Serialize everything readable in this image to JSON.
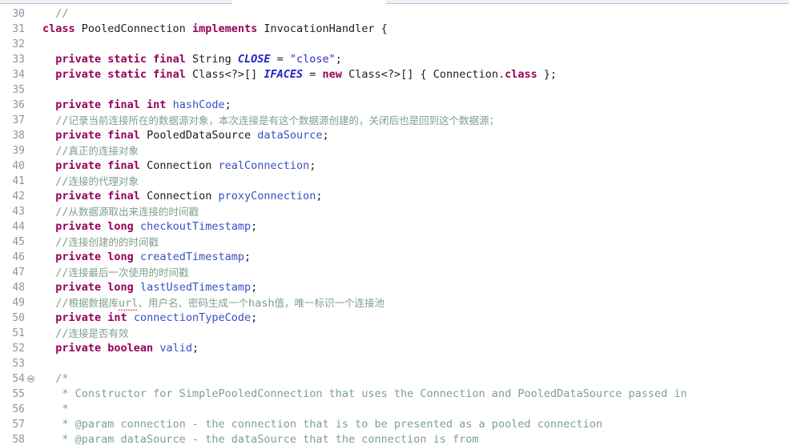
{
  "editor": {
    "language": "Java",
    "theme": "light",
    "first_line": 30,
    "last_line": 58,
    "colors": {
      "background": "#ffffff",
      "gutter_text": "#8f9499",
      "keyword": "#96005a",
      "field": "#3b4ec4",
      "constant": "#2323c8",
      "string": "#2a2ac0",
      "comment": "#7f9f8f",
      "text": "#1d1d1d",
      "spellcheck_underline": "#e05050"
    }
  },
  "lines": [
    {
      "number": "30",
      "fold": false,
      "tokens": [
        {
          "t": "  ",
          "c": "plain"
        },
        {
          "t": "//",
          "c": "cmt"
        }
      ]
    },
    {
      "number": "31",
      "fold": false,
      "tokens": [
        {
          "t": "class",
          "c": "kw"
        },
        {
          "t": " PooledConnection ",
          "c": "type"
        },
        {
          "t": "implements",
          "c": "kw"
        },
        {
          "t": " InvocationHandler {",
          "c": "type"
        }
      ]
    },
    {
      "number": "32",
      "fold": false,
      "tokens": []
    },
    {
      "number": "33",
      "fold": false,
      "tokens": [
        {
          "t": "  ",
          "c": "plain"
        },
        {
          "t": "private static final",
          "c": "kw"
        },
        {
          "t": " String ",
          "c": "type"
        },
        {
          "t": "CLOSE",
          "c": "constant"
        },
        {
          "t": " = ",
          "c": "punct"
        },
        {
          "t": "\"close\"",
          "c": "str"
        },
        {
          "t": ";",
          "c": "punct"
        }
      ]
    },
    {
      "number": "34",
      "fold": false,
      "tokens": [
        {
          "t": "  ",
          "c": "plain"
        },
        {
          "t": "private static final",
          "c": "kw"
        },
        {
          "t": " Class<?>[] ",
          "c": "type"
        },
        {
          "t": "IFACES",
          "c": "constant"
        },
        {
          "t": " = ",
          "c": "punct"
        },
        {
          "t": "new",
          "c": "kw"
        },
        {
          "t": " Class<?>[] { Connection.",
          "c": "type"
        },
        {
          "t": "class",
          "c": "kw"
        },
        {
          "t": " };",
          "c": "punct"
        }
      ]
    },
    {
      "number": "35",
      "fold": false,
      "tokens": []
    },
    {
      "number": "36",
      "fold": false,
      "tokens": [
        {
          "t": "  ",
          "c": "plain"
        },
        {
          "t": "private final int",
          "c": "kw"
        },
        {
          "t": " ",
          "c": "plain"
        },
        {
          "t": "hashCode",
          "c": "field"
        },
        {
          "t": ";",
          "c": "punct"
        }
      ]
    },
    {
      "number": "37",
      "fold": false,
      "tokens": [
        {
          "t": "  ",
          "c": "plain"
        },
        {
          "t": "//",
          "c": "cmt"
        },
        {
          "t": "记录当前连接所在的数据源对象，本次连接是有这个数据源创建的，关闭后也是回到这个数据源；",
          "c": "cmt cjk"
        }
      ]
    },
    {
      "number": "38",
      "fold": false,
      "tokens": [
        {
          "t": "  ",
          "c": "plain"
        },
        {
          "t": "private final",
          "c": "kw"
        },
        {
          "t": " PooledDataSource ",
          "c": "type"
        },
        {
          "t": "dataSource",
          "c": "field"
        },
        {
          "t": ";",
          "c": "punct"
        }
      ]
    },
    {
      "number": "39",
      "fold": false,
      "tokens": [
        {
          "t": "  ",
          "c": "plain"
        },
        {
          "t": "//",
          "c": "cmt"
        },
        {
          "t": "真正的连接对象",
          "c": "cmt cjk"
        }
      ]
    },
    {
      "number": "40",
      "fold": false,
      "tokens": [
        {
          "t": "  ",
          "c": "plain"
        },
        {
          "t": "private final",
          "c": "kw"
        },
        {
          "t": " Connection ",
          "c": "type"
        },
        {
          "t": "realConnection",
          "c": "field"
        },
        {
          "t": ";",
          "c": "punct"
        }
      ]
    },
    {
      "number": "41",
      "fold": false,
      "tokens": [
        {
          "t": "  ",
          "c": "plain"
        },
        {
          "t": "//",
          "c": "cmt"
        },
        {
          "t": "连接的代理对象",
          "c": "cmt cjk"
        }
      ]
    },
    {
      "number": "42",
      "fold": false,
      "tokens": [
        {
          "t": "  ",
          "c": "plain"
        },
        {
          "t": "private final",
          "c": "kw"
        },
        {
          "t": " Connection ",
          "c": "type"
        },
        {
          "t": "proxyConnection",
          "c": "field"
        },
        {
          "t": ";",
          "c": "punct"
        }
      ]
    },
    {
      "number": "43",
      "fold": false,
      "tokens": [
        {
          "t": "  ",
          "c": "plain"
        },
        {
          "t": "//",
          "c": "cmt"
        },
        {
          "t": "从数据源取出来连接的时间戳",
          "c": "cmt cjk"
        }
      ]
    },
    {
      "number": "44",
      "fold": false,
      "tokens": [
        {
          "t": "  ",
          "c": "plain"
        },
        {
          "t": "private long",
          "c": "kw"
        },
        {
          "t": " ",
          "c": "plain"
        },
        {
          "t": "checkoutTimestamp",
          "c": "field"
        },
        {
          "t": ";",
          "c": "punct"
        }
      ]
    },
    {
      "number": "45",
      "fold": false,
      "tokens": [
        {
          "t": "  ",
          "c": "plain"
        },
        {
          "t": "//",
          "c": "cmt"
        },
        {
          "t": "连接创建的的时间戳",
          "c": "cmt cjk"
        }
      ]
    },
    {
      "number": "46",
      "fold": false,
      "tokens": [
        {
          "t": "  ",
          "c": "plain"
        },
        {
          "t": "private long",
          "c": "kw"
        },
        {
          "t": " ",
          "c": "plain"
        },
        {
          "t": "createdTimestamp",
          "c": "field"
        },
        {
          "t": ";",
          "c": "punct"
        }
      ]
    },
    {
      "number": "47",
      "fold": false,
      "tokens": [
        {
          "t": "  ",
          "c": "plain"
        },
        {
          "t": "//",
          "c": "cmt"
        },
        {
          "t": "连接最后一次使用的时间戳",
          "c": "cmt cjk"
        }
      ]
    },
    {
      "number": "48",
      "fold": false,
      "tokens": [
        {
          "t": "  ",
          "c": "plain"
        },
        {
          "t": "private long",
          "c": "kw"
        },
        {
          "t": " ",
          "c": "plain"
        },
        {
          "t": "lastUsedTimestamp",
          "c": "field"
        },
        {
          "t": ";",
          "c": "punct"
        }
      ]
    },
    {
      "number": "49",
      "fold": false,
      "tokens": [
        {
          "t": "  ",
          "c": "plain"
        },
        {
          "t": "//",
          "c": "cmt"
        },
        {
          "t": "根据数据库",
          "c": "cmt cjk"
        },
        {
          "t": "url",
          "c": "cmt typo"
        },
        {
          "t": "、用户名、密码生成一个",
          "c": "cmt cjk"
        },
        {
          "t": "hash",
          "c": "cmt"
        },
        {
          "t": "值，唯一标识一个连接池",
          "c": "cmt cjk"
        }
      ]
    },
    {
      "number": "50",
      "fold": false,
      "tokens": [
        {
          "t": "  ",
          "c": "plain"
        },
        {
          "t": "private int",
          "c": "kw"
        },
        {
          "t": " ",
          "c": "plain"
        },
        {
          "t": "connectionTypeCode",
          "c": "field"
        },
        {
          "t": ";",
          "c": "punct"
        }
      ]
    },
    {
      "number": "51",
      "fold": false,
      "tokens": [
        {
          "t": "  ",
          "c": "plain"
        },
        {
          "t": "//",
          "c": "cmt"
        },
        {
          "t": "连接是否有效",
          "c": "cmt cjk"
        }
      ]
    },
    {
      "number": "52",
      "fold": false,
      "tokens": [
        {
          "t": "  ",
          "c": "plain"
        },
        {
          "t": "private boolean",
          "c": "kw"
        },
        {
          "t": " ",
          "c": "plain"
        },
        {
          "t": "valid",
          "c": "field"
        },
        {
          "t": ";",
          "c": "punct"
        }
      ]
    },
    {
      "number": "53",
      "fold": false,
      "tokens": []
    },
    {
      "number": "54",
      "fold": true,
      "tokens": [
        {
          "t": "  /*",
          "c": "cmt"
        }
      ]
    },
    {
      "number": "55",
      "fold": false,
      "tokens": [
        {
          "t": "   * Constructor for SimplePooledConnection that uses the Connection and PooledDataSource passed in",
          "c": "cmt"
        }
      ]
    },
    {
      "number": "56",
      "fold": false,
      "tokens": [
        {
          "t": "   *",
          "c": "cmt"
        }
      ]
    },
    {
      "number": "57",
      "fold": false,
      "tokens": [
        {
          "t": "   * @param connection - the connection that is to be presented as a pooled connection",
          "c": "cmt"
        }
      ]
    },
    {
      "number": "58",
      "fold": false,
      "tokens": [
        {
          "t": "   * @param dataSource - the dataSource that the connection is from",
          "c": "cmt"
        }
      ]
    }
  ]
}
